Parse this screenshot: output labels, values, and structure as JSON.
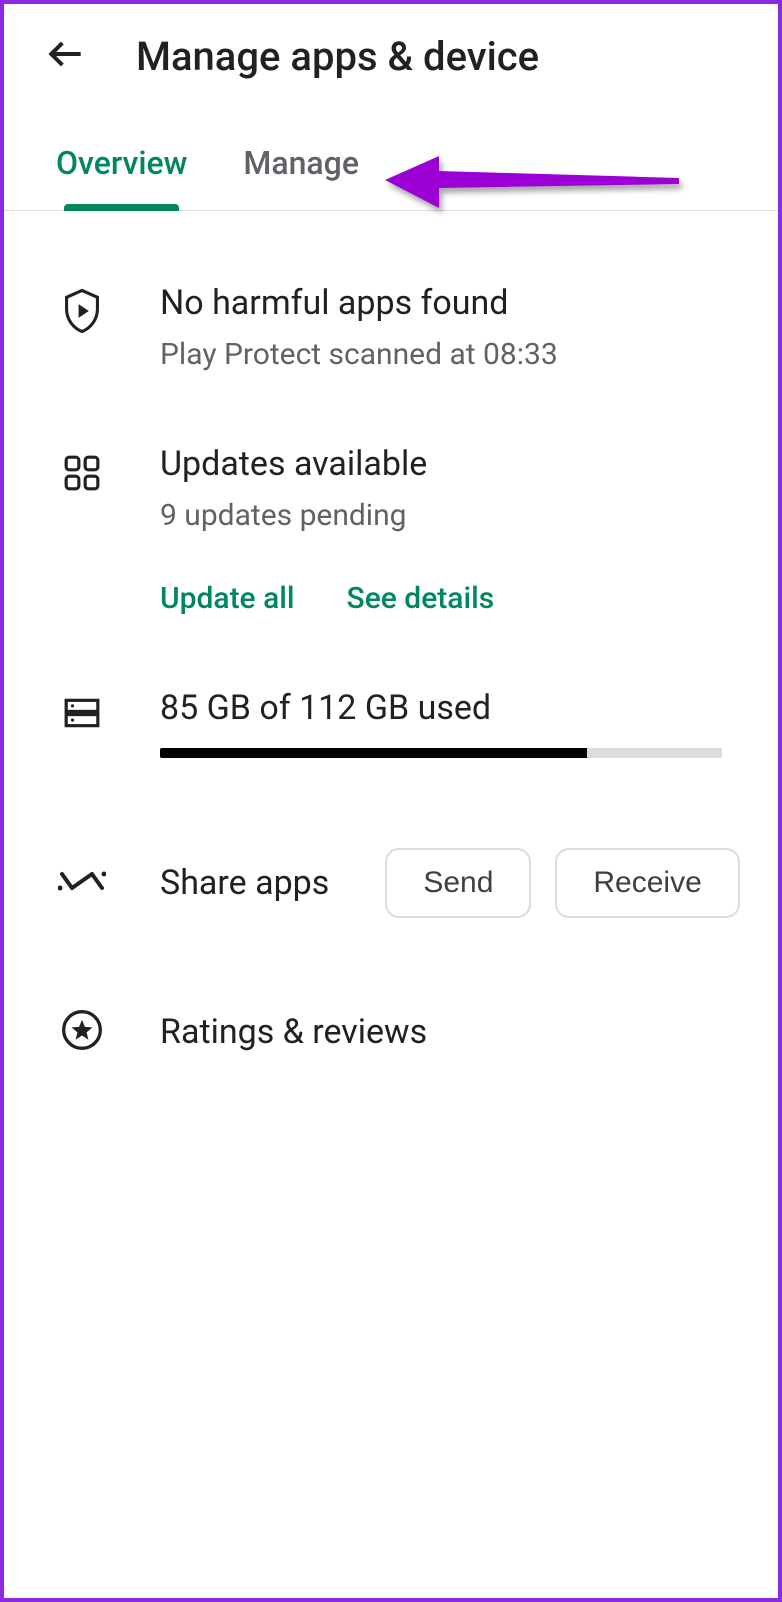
{
  "header": {
    "title": "Manage apps & device"
  },
  "tabs": {
    "overview": "Overview",
    "manage": "Manage"
  },
  "protect": {
    "title": "No harmful apps found",
    "sub": "Play Protect scanned at 08:33"
  },
  "updates": {
    "title": "Updates available",
    "sub": "9 updates pending",
    "update_all": "Update all",
    "see_details": "See details"
  },
  "storage": {
    "text": "85 GB of 112 GB used",
    "percent": 76
  },
  "share": {
    "label": "Share apps",
    "send": "Send",
    "receive": "Receive"
  },
  "ratings": {
    "label": "Ratings & reviews"
  },
  "colors": {
    "accent": "#00875f",
    "annotation": "#9c00d4"
  }
}
